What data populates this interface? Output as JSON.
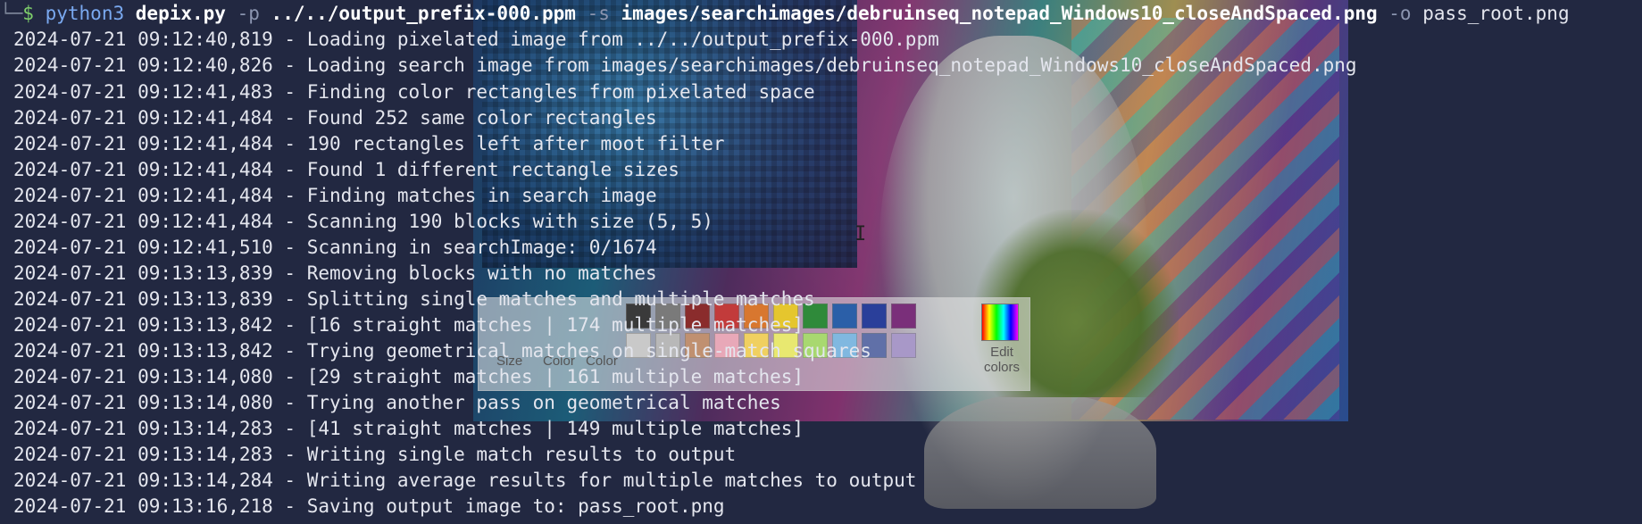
{
  "prompt": {
    "corner": "└─",
    "symbol": "$",
    "command": "python3",
    "script": "depix.py",
    "flag_p": "-p",
    "pixelated_path": "../../output_prefix-000.ppm",
    "flag_s": "-s",
    "search_path": "images/searchimages/debruinseq_notepad_Windows10_closeAndSpaced.png",
    "flag_o": "-o",
    "output_path": "pass_root.png"
  },
  "log_lines": [
    "2024-07-21 09:12:40,819 - Loading pixelated image from ../../output_prefix-000.ppm",
    "2024-07-21 09:12:40,826 - Loading search image from images/searchimages/debruinseq_notepad_Windows10_closeAndSpaced.png",
    "2024-07-21 09:12:41,483 - Finding color rectangles from pixelated space",
    "2024-07-21 09:12:41,484 - Found 252 same color rectangles",
    "2024-07-21 09:12:41,484 - 190 rectangles left after moot filter",
    "2024-07-21 09:12:41,484 - Found 1 different rectangle sizes",
    "2024-07-21 09:12:41,484 - Finding matches in search image",
    "2024-07-21 09:12:41,484 - Scanning 190 blocks with size (5, 5)",
    "2024-07-21 09:12:41,510 - Scanning in searchImage: 0/1674",
    "2024-07-21 09:13:13,839 - Removing blocks with no matches",
    "2024-07-21 09:13:13,839 - Splitting single matches and multiple matches",
    "2024-07-21 09:13:13,842 - [16 straight matches | 174 multiple matches]",
    "2024-07-21 09:13:13,842 - Trying geometrical matches on single-match squares",
    "2024-07-21 09:13:14,080 - [29 straight matches | 161 multiple matches]",
    "2024-07-21 09:13:14,080 - Trying another pass on geometrical matches",
    "2024-07-21 09:13:14,283 - [41 straight matches | 149 multiple matches]",
    "2024-07-21 09:13:14,283 - Writing single match results to output",
    "2024-07-21 09:13:14,284 - Writing average results for multiple matches to output",
    "2024-07-21 09:13:16,218 - Saving output image to: pass_root.png"
  ],
  "wallpaper_palette": {
    "labels": [
      "Size",
      "Color",
      "Color",
      "Edit colors"
    ],
    "swatches": [
      "#3a3a3a",
      "#7a7a7a",
      "#8a2c2c",
      "#c23b3b",
      "#d8772f",
      "#e5c62e",
      "#2f8a3a",
      "#2b5fa8",
      "#2a3f9a",
      "#7a2f7a",
      "#c9c9c9",
      "#b8b8b8",
      "#c09070",
      "#e8a8b8",
      "#f0d060",
      "#e8e870",
      "#a8d870",
      "#80b8e0",
      "#6070a8",
      "#a898c8"
    ],
    "edit_colors_label": "Edit colors"
  },
  "colors": {
    "background": "#222841",
    "text": "#e4e6ee",
    "prompt_symbol": "#7fd06b",
    "command": "#7aa9f0",
    "flag": "#8b95b0"
  }
}
